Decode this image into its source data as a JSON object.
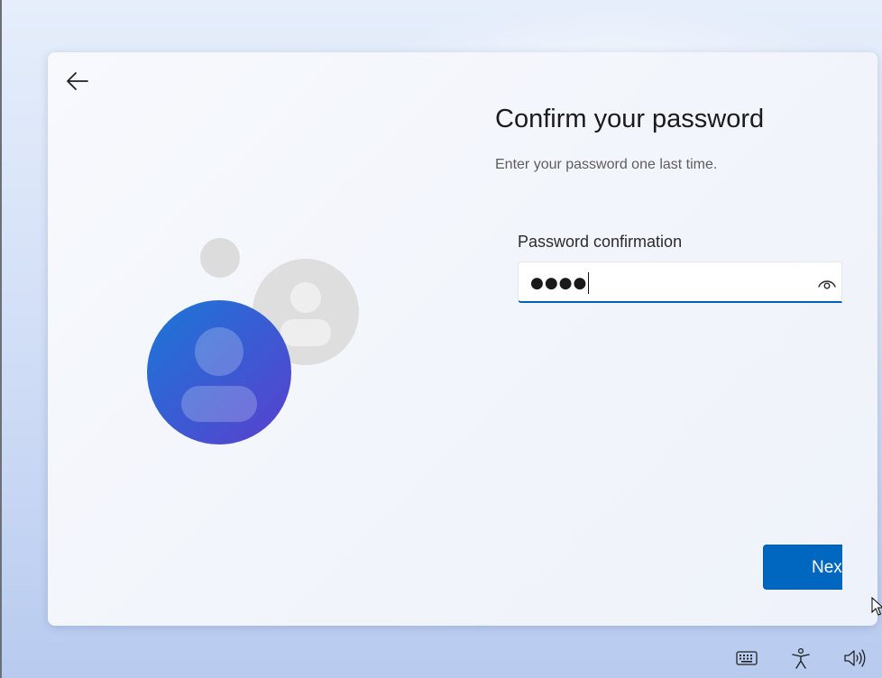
{
  "dialog": {
    "title": "Confirm your password",
    "subtitle": "Enter your password one last time.",
    "field": {
      "label": "Password confirmation",
      "masked_value": "●●●●"
    },
    "next_label": "Next"
  },
  "icons": {
    "back": "back-arrow-icon",
    "reveal": "eye-icon",
    "keyboard": "keyboard-icon",
    "accessibility": "accessibility-icon",
    "volume": "volume-icon"
  },
  "colors": {
    "accent": "#0067c0",
    "avatar_gradient_start": "#1a78d8",
    "avatar_gradient_end": "#5a3fce",
    "placeholder_avatar": "#dcdcdc"
  }
}
